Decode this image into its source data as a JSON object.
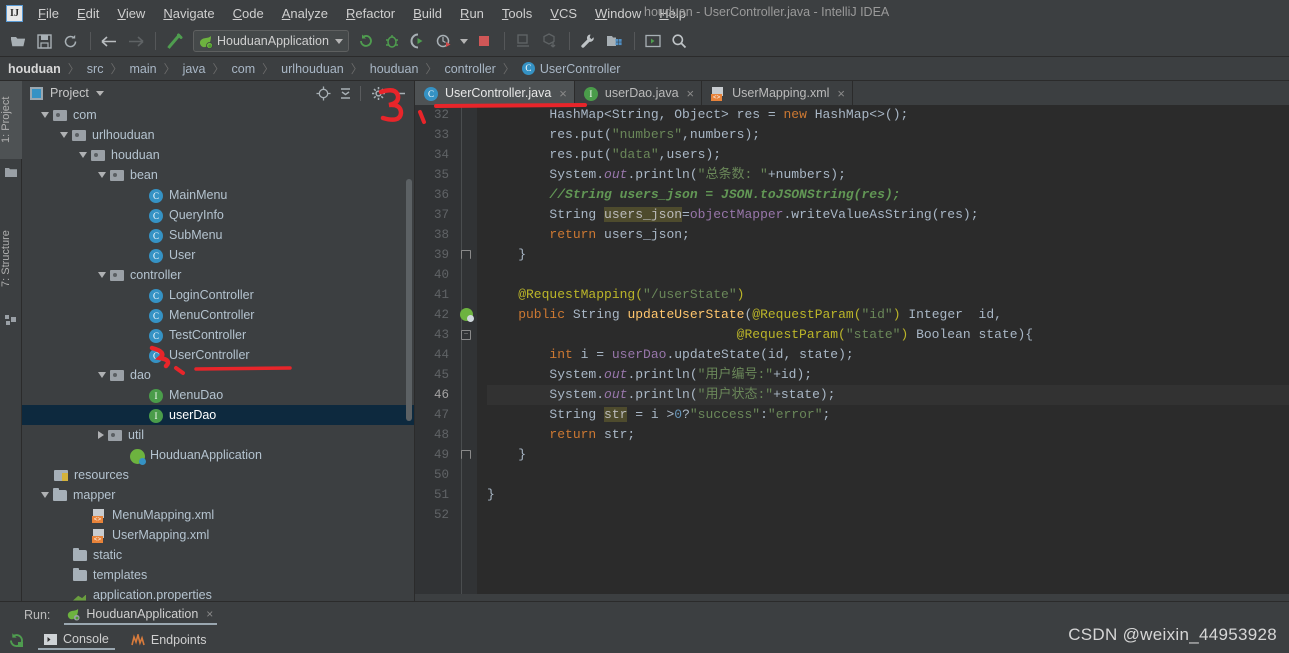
{
  "window": {
    "title": "houduan - UserController.java - IntelliJ IDEA",
    "logo": "IJ"
  },
  "menu": {
    "items": [
      {
        "label": "File"
      },
      {
        "label": "Edit"
      },
      {
        "label": "View"
      },
      {
        "label": "Navigate"
      },
      {
        "label": "Code"
      },
      {
        "label": "Analyze"
      },
      {
        "label": "Refactor"
      },
      {
        "label": "Build"
      },
      {
        "label": "Run"
      },
      {
        "label": "Tools"
      },
      {
        "label": "VCS"
      },
      {
        "label": "Window"
      },
      {
        "label": "Help"
      }
    ]
  },
  "toolbar": {
    "run_config": "HouduanApplication",
    "icons": [
      "open-folder-icon",
      "save-all-icon",
      "sync-icon",
      "back-arrow-icon",
      "forward-arrow-icon",
      "build-hammer-icon",
      "rerun-icon",
      "debug-bug-icon",
      "run-with-coverage-icon",
      "profiler-icon",
      "stop-icon",
      "update-app-icon",
      "push-icon",
      "settings-wrench-icon",
      "project-structure-icon",
      "open-terminal-icon",
      "search-everywhere-icon"
    ]
  },
  "breadcrumb": {
    "items": [
      "houduan",
      "src",
      "main",
      "java",
      "com",
      "urlhouduan",
      "houduan",
      "controller"
    ],
    "leaf": "UserController",
    "leaf_icon": "C"
  },
  "rail": {
    "top_tab": "1: Project",
    "bottom_tab": "7: Structure"
  },
  "project_panel": {
    "title": "Project",
    "icons": [
      "locate-target-icon",
      "collapse-all-icon",
      "gear-icon",
      "hide-icon"
    ],
    "tree": [
      {
        "depth": 1,
        "arrow": "down",
        "icon": "pkg-folder",
        "label": "com"
      },
      {
        "depth": 2,
        "arrow": "down",
        "icon": "pkg-folder",
        "label": "urlhouduan"
      },
      {
        "depth": 3,
        "arrow": "down",
        "icon": "pkg-folder",
        "label": "houduan"
      },
      {
        "depth": 4,
        "arrow": "down",
        "icon": "pkg-folder",
        "label": "bean"
      },
      {
        "depth": 6,
        "arrow": "none",
        "icon": "class-icon",
        "label": "MainMenu"
      },
      {
        "depth": 6,
        "arrow": "none",
        "icon": "class-icon",
        "label": "QueryInfo"
      },
      {
        "depth": 6,
        "arrow": "none",
        "icon": "class-icon",
        "label": "SubMenu"
      },
      {
        "depth": 6,
        "arrow": "none",
        "icon": "class-icon",
        "label": "User"
      },
      {
        "depth": 4,
        "arrow": "down",
        "icon": "pkg-folder",
        "label": "controller"
      },
      {
        "depth": 6,
        "arrow": "none",
        "icon": "class-icon",
        "label": "LoginController"
      },
      {
        "depth": 6,
        "arrow": "none",
        "icon": "class-icon",
        "label": "MenuController"
      },
      {
        "depth": 6,
        "arrow": "none",
        "icon": "class-icon",
        "label": "TestController"
      },
      {
        "depth": 6,
        "arrow": "none",
        "icon": "class-icon",
        "label": "UserController"
      },
      {
        "depth": 4,
        "arrow": "down",
        "icon": "pkg-folder",
        "label": "dao"
      },
      {
        "depth": 6,
        "arrow": "none",
        "icon": "interface-icon",
        "label": "MenuDao"
      },
      {
        "depth": 6,
        "arrow": "none",
        "icon": "interface-icon",
        "label": "userDao",
        "selected": true
      },
      {
        "depth": 4,
        "arrow": "right",
        "icon": "pkg-folder",
        "label": "util"
      },
      {
        "depth": 5,
        "arrow": "none",
        "icon": "spring-icon",
        "label": "HouduanApplication"
      },
      {
        "depth": 1,
        "arrow": "none",
        "icon": "resources-folder",
        "label": "resources"
      },
      {
        "depth": 1,
        "arrow": "down",
        "icon": "plain-folder",
        "label": "mapper"
      },
      {
        "depth": 3,
        "arrow": "none",
        "icon": "xml-icon",
        "label": "MenuMapping.xml"
      },
      {
        "depth": 3,
        "arrow": "none",
        "icon": "xml-icon",
        "label": "UserMapping.xml"
      },
      {
        "depth": 2,
        "arrow": "none",
        "icon": "plain-folder",
        "label": "static"
      },
      {
        "depth": 2,
        "arrow": "none",
        "icon": "plain-folder",
        "label": "templates"
      },
      {
        "depth": 2,
        "arrow": "none",
        "icon": "properties-icon",
        "label": "application.properties"
      }
    ]
  },
  "editor": {
    "tabs": [
      {
        "label": "UserController.java",
        "icon": "class-icon",
        "active": true,
        "close": "×"
      },
      {
        "label": "userDao.java",
        "icon": "interface-icon",
        "active": false,
        "close": "×"
      },
      {
        "label": "UserMapping.xml",
        "icon": "xml-icon",
        "active": false,
        "close": "×"
      }
    ],
    "first_line_number": 32,
    "last_line_number": 52,
    "current_line": 46,
    "gutter_marks": {
      "bean_line": 42,
      "fold_lines": [
        39,
        43,
        49
      ]
    },
    "lines": [
      {
        "n": 32,
        "tokens": [
          {
            "t": "        HashMap",
            "c": "pl"
          },
          {
            "t": "<String, Object> res = ",
            "c": "pl"
          },
          {
            "t": "new ",
            "c": "k"
          },
          {
            "t": "HashMap<>();",
            "c": "pl"
          }
        ]
      },
      {
        "n": 33,
        "tokens": [
          {
            "t": "        res.put(",
            "c": "pl"
          },
          {
            "t": "\"numbers\"",
            "c": "s"
          },
          {
            "t": ",numbers);",
            "c": "pl"
          }
        ]
      },
      {
        "n": 34,
        "tokens": [
          {
            "t": "        res.put(",
            "c": "pl"
          },
          {
            "t": "\"data\"",
            "c": "s"
          },
          {
            "t": ",users);",
            "c": "pl"
          }
        ]
      },
      {
        "n": 35,
        "tokens": [
          {
            "t": "        System.",
            "c": "pl"
          },
          {
            "t": "out",
            "c": "fdi"
          },
          {
            "t": ".println(",
            "c": "pl"
          },
          {
            "t": "\"总条数: \"",
            "c": "s"
          },
          {
            "t": "+numbers);",
            "c": "pl"
          }
        ]
      },
      {
        "n": 36,
        "tokens": [
          {
            "t": "        //String users_json = JSON.toJSONString(res);",
            "c": "cm"
          }
        ]
      },
      {
        "n": 37,
        "tokens": [
          {
            "t": "        String ",
            "c": "pl"
          },
          {
            "t": "users_json",
            "c": "hl"
          },
          {
            "t": "=",
            "c": "pl"
          },
          {
            "t": "objectMapper",
            "c": "fd"
          },
          {
            "t": ".writeValueAsString(res);",
            "c": "pl"
          }
        ]
      },
      {
        "n": 38,
        "tokens": [
          {
            "t": "        ",
            "c": "pl"
          },
          {
            "t": "return ",
            "c": "k"
          },
          {
            "t": "users_json;",
            "c": "pl"
          }
        ]
      },
      {
        "n": 39,
        "tokens": [
          {
            "t": "    }",
            "c": "pl"
          }
        ]
      },
      {
        "n": 40,
        "tokens": [
          {
            "t": "",
            "c": "pl"
          }
        ]
      },
      {
        "n": 41,
        "tokens": [
          {
            "t": "    @RequestMapping(",
            "c": "an"
          },
          {
            "t": "\"/userState\"",
            "c": "s"
          },
          {
            "t": ")",
            "c": "an"
          }
        ]
      },
      {
        "n": 42,
        "tokens": [
          {
            "t": "    public ",
            "c": "k"
          },
          {
            "t": "String ",
            "c": "pl"
          },
          {
            "t": "updateUserState",
            "c": "mt"
          },
          {
            "t": "(",
            "c": "pl"
          },
          {
            "t": "@RequestParam(",
            "c": "an"
          },
          {
            "t": "\"id\"",
            "c": "s"
          },
          {
            "t": ") ",
            "c": "an"
          },
          {
            "t": "Integer  id,",
            "c": "pl"
          }
        ]
      },
      {
        "n": 43,
        "tokens": [
          {
            "t": "                                ",
            "c": "pl"
          },
          {
            "t": "@RequestParam(",
            "c": "an"
          },
          {
            "t": "\"state\"",
            "c": "s"
          },
          {
            "t": ") ",
            "c": "an"
          },
          {
            "t": "Boolean state){",
            "c": "pl"
          }
        ]
      },
      {
        "n": 44,
        "tokens": [
          {
            "t": "        int ",
            "c": "k"
          },
          {
            "t": "i = ",
            "c": "pl"
          },
          {
            "t": "userDao",
            "c": "fd"
          },
          {
            "t": ".updateState(id, state);",
            "c": "pl"
          }
        ]
      },
      {
        "n": 45,
        "tokens": [
          {
            "t": "        System.",
            "c": "pl"
          },
          {
            "t": "out",
            "c": "fdi"
          },
          {
            "t": ".println(",
            "c": "pl"
          },
          {
            "t": "\"用户编号:\"",
            "c": "s"
          },
          {
            "t": "+id);",
            "c": "pl"
          }
        ]
      },
      {
        "n": 46,
        "tokens": [
          {
            "t": "        System.",
            "c": "pl"
          },
          {
            "t": "out",
            "c": "fdi"
          },
          {
            "t": ".println(",
            "c": "pl"
          },
          {
            "t": "\"用户状态:\"",
            "c": "s"
          },
          {
            "t": "+state);",
            "c": "pl"
          }
        ]
      },
      {
        "n": 47,
        "tokens": [
          {
            "t": "        String ",
            "c": "pl"
          },
          {
            "t": "str",
            "c": "hl"
          },
          {
            "t": " = i >",
            "c": "pl"
          },
          {
            "t": "0",
            "c": "n"
          },
          {
            "t": "?",
            "c": "pl"
          },
          {
            "t": "\"success\"",
            "c": "s"
          },
          {
            "t": ":",
            "c": "pl"
          },
          {
            "t": "\"error\"",
            "c": "s"
          },
          {
            "t": ";",
            "c": "pl"
          }
        ]
      },
      {
        "n": 48,
        "tokens": [
          {
            "t": "        ",
            "c": "pl"
          },
          {
            "t": "return ",
            "c": "k"
          },
          {
            "t": "str;",
            "c": "pl"
          }
        ]
      },
      {
        "n": 49,
        "tokens": [
          {
            "t": "    }",
            "c": "pl"
          }
        ]
      },
      {
        "n": 50,
        "tokens": [
          {
            "t": "",
            "c": "pl"
          }
        ]
      },
      {
        "n": 51,
        "tokens": [
          {
            "t": "}",
            "c": "pl"
          }
        ]
      },
      {
        "n": 52,
        "tokens": [
          {
            "t": "",
            "c": "pl"
          }
        ]
      }
    ]
  },
  "run_panel": {
    "run_label": "Run:",
    "config_name": "HouduanApplication",
    "close": "×",
    "tabs": [
      {
        "label": "Console",
        "icon": "console-icon",
        "active": true
      },
      {
        "label": "Endpoints",
        "icon": "endpoints-icon",
        "active": false
      }
    ],
    "rerun_icon": "rerun-icon"
  },
  "watermark": "CSDN @weixin_44953928",
  "colors": {
    "panel_bg": "#3c3f41",
    "editor_bg": "#2b2b2b",
    "gutter_bg": "#313335",
    "selection_blue": "#0d293e",
    "accent_blue": "#3592c4",
    "spring_green": "#6db33f",
    "annotation_red": "#e8252a",
    "keyword_orange": "#cc7832",
    "string_green": "#6a8759",
    "comment_green": "#629755",
    "annot_yellow": "#bbb529",
    "field_purple": "#9876aa",
    "method_gold": "#ffc66d",
    "text_fg": "#a9b7c6"
  },
  "annotations": {
    "number_three": "3",
    "arrow_pointer": "→"
  }
}
